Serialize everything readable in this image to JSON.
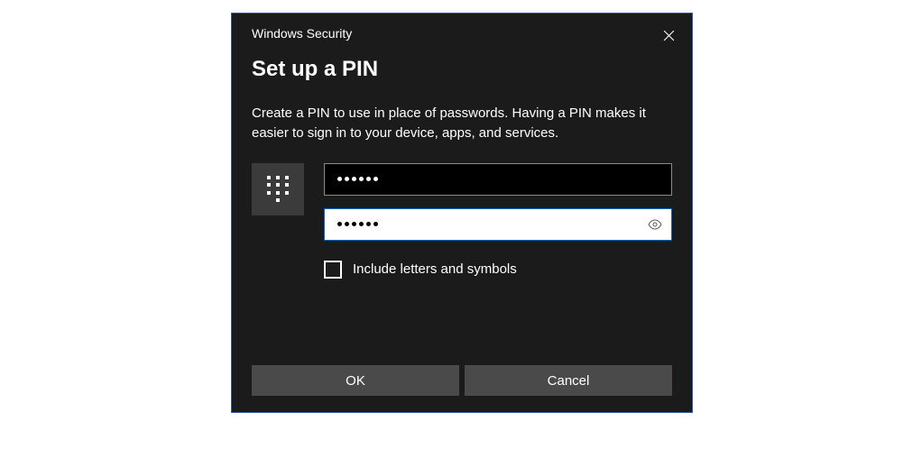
{
  "dialog": {
    "app_name": "Windows Security",
    "title": "Set up a PIN",
    "description": "Create a PIN to use in place of passwords. Having a PIN makes it easier to sign in to your device, apps, and services.",
    "pin_value_masked": "••••••",
    "confirm_pin_value_masked": "••••••",
    "include_letters_label": "Include letters and symbols",
    "include_letters_checked": false,
    "buttons": {
      "ok": "OK",
      "cancel": "Cancel"
    }
  }
}
